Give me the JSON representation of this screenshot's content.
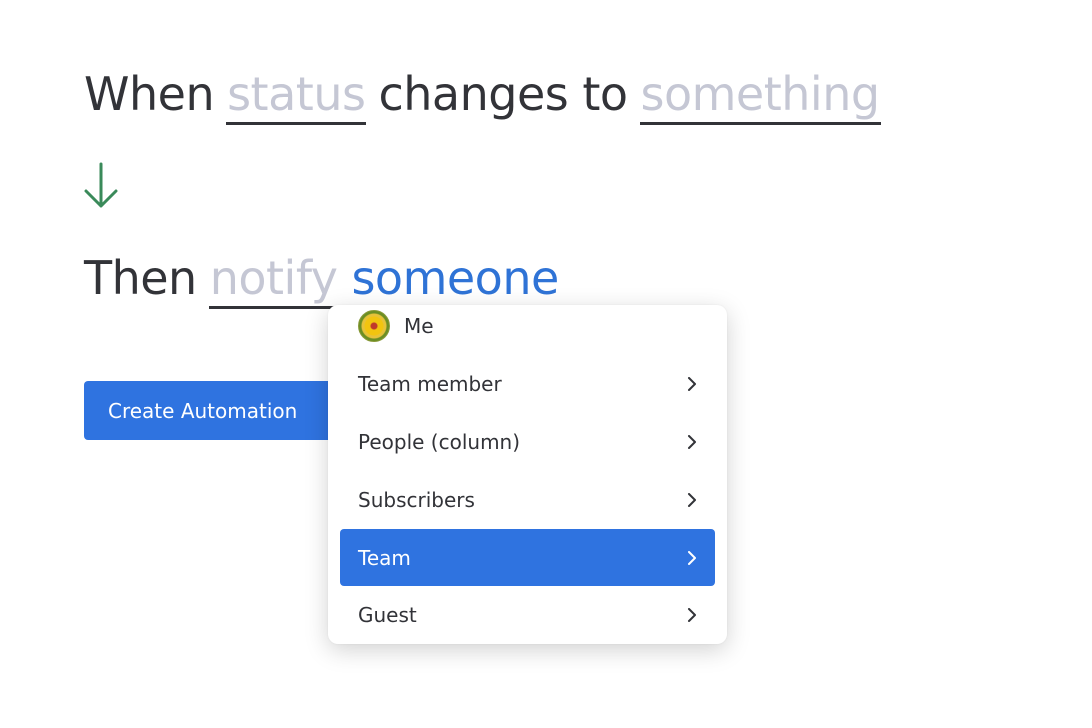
{
  "trigger": {
    "prefix": "When",
    "field": "status",
    "middle": "changes to",
    "value": "something"
  },
  "action": {
    "prefix": "Then",
    "verb": "notify",
    "target": "someone"
  },
  "create_button": "Create Automation",
  "menu": {
    "items": [
      {
        "label": "Me"
      },
      {
        "label": "Team member"
      },
      {
        "label": "People (column)"
      },
      {
        "label": "Subscribers"
      },
      {
        "label": "Team"
      },
      {
        "label": "Guest"
      }
    ],
    "selected": "Team"
  },
  "colors": {
    "accent": "#2f73e0",
    "arrow": "#3a8a5a",
    "placeholder": "#c5c7d4",
    "text": "#323338"
  }
}
